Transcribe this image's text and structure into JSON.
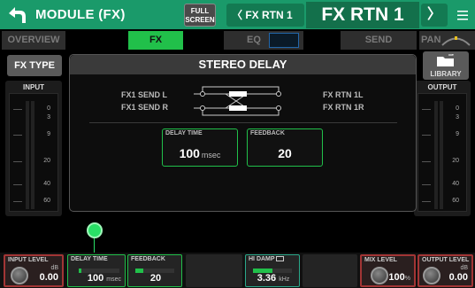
{
  "header": {
    "module_title": "MODULE (FX)",
    "fullscreen_line1": "FULL",
    "fullscreen_line2": "SCREEN",
    "prev_channel": "〈 FX RTN 1",
    "channel_name": "FX RTN 1",
    "next_channel": "〉"
  },
  "tabs": {
    "overview": "OVERVIEW",
    "fx": "FX",
    "eq": "EQ",
    "send": "SEND",
    "pan": "PAN"
  },
  "left": {
    "fx_type_label": "FX TYPE",
    "meter_title": "INPUT",
    "scale": [
      "0",
      "3",
      "9",
      "20",
      "40",
      "60"
    ]
  },
  "right": {
    "library_label": "LIBRARY",
    "meter_title": "OUTPUT",
    "scale": [
      "0",
      "3",
      "9",
      "20",
      "40",
      "60"
    ]
  },
  "effect": {
    "name": "STEREO DELAY",
    "inputs": [
      "FX1 SEND L",
      "FX1 SEND R"
    ],
    "outputs": [
      "FX RTN 1L",
      "FX RTN 1R"
    ],
    "delay_time": {
      "title": "DELAY TIME",
      "value": "100",
      "unit": "msec"
    },
    "feedback": {
      "title": "FEEDBACK",
      "value": "20"
    }
  },
  "strip": {
    "input_level": {
      "title": "INPUT LEVEL",
      "unit": "dB",
      "value": "0.00"
    },
    "delay_time": {
      "title": "DELAY TIME",
      "value": "100",
      "unit": "msec",
      "level": 0.05
    },
    "feedback": {
      "title": "FEEDBACK",
      "value": "20",
      "level": 0.2
    },
    "hi_damp": {
      "title": "HI DAMP",
      "value": "3.36",
      "unit": "kHz",
      "level": 0.5
    },
    "mix_level": {
      "title": "MIX LEVEL",
      "value": "100",
      "unit": "%"
    },
    "output_level": {
      "title": "OUTPUT LEVEL",
      "unit": "dB",
      "value": "0.00"
    }
  },
  "colors": {
    "title_bar": "#1a9a6a",
    "active_tab": "#21c04a",
    "level_border": "#a23535"
  }
}
